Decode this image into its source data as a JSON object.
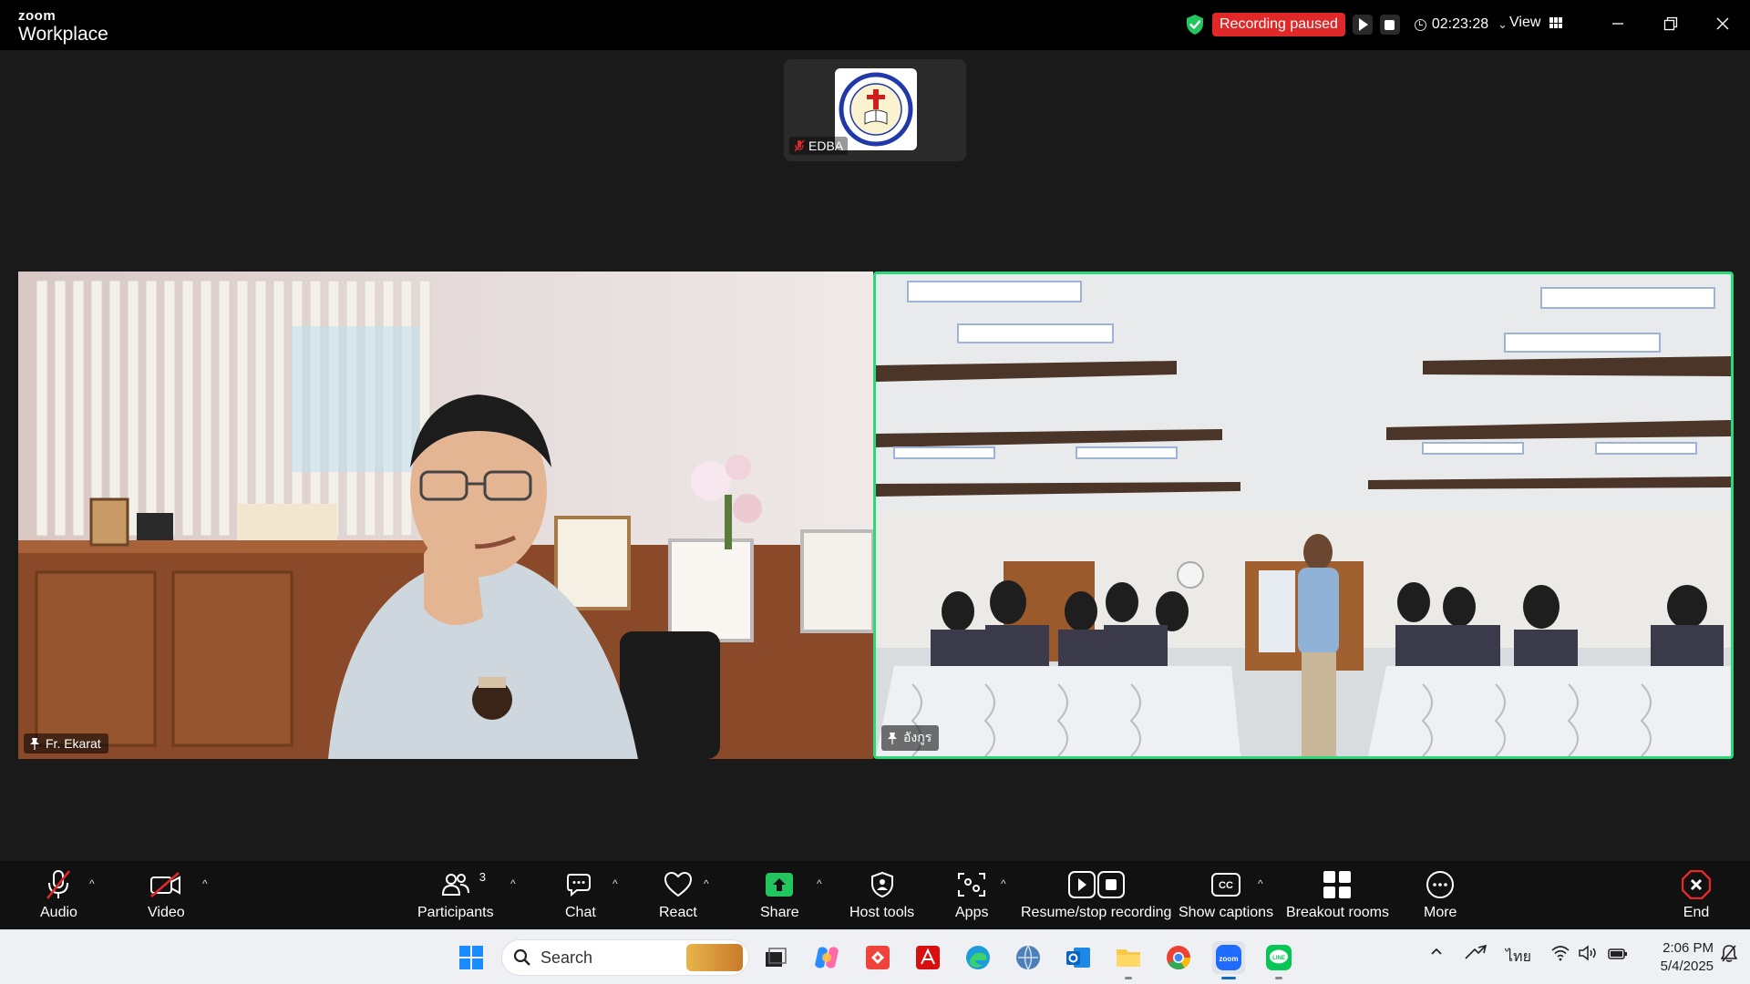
{
  "app": {
    "brand_top": "zoom",
    "brand_bottom": "Workplace"
  },
  "recording": {
    "status": "Recording paused",
    "elapsed": "02:23:28"
  },
  "titlebar": {
    "view_label": "View"
  },
  "participants_tiles": {
    "thumbnail": {
      "name": "EDBA",
      "muted": true
    },
    "left": {
      "name": "Fr. Ekarat",
      "pinned": true
    },
    "right": {
      "name": "อังกูร",
      "pinned": true,
      "active_speaker": true
    }
  },
  "toolbar": {
    "audio": "Audio",
    "video": "Video",
    "participants": "Participants",
    "participants_count": "3",
    "chat": "Chat",
    "react": "React",
    "share": "Share",
    "host_tools": "Host tools",
    "apps": "Apps",
    "recording": "Resume/stop recording",
    "captions": "Show captions",
    "breakout": "Breakout rooms",
    "more": "More",
    "end": "End"
  },
  "colors": {
    "accent_green": "#2bd97b",
    "recording_red": "#e02828",
    "end_red": "#e02828",
    "share_green": "#22c55e"
  },
  "taskbar": {
    "search_placeholder": "Search",
    "language": "ไทย",
    "time": "2:06 PM",
    "date": "5/4/2025",
    "pinned_apps": [
      "start-icon",
      "search-icon",
      "task-view-icon",
      "copilot-icon",
      "anydesk-icon",
      "acrobat-icon",
      "edge-icon",
      "globe-app-icon",
      "outlook-icon",
      "file-explorer-icon",
      "chrome-icon",
      "zoom-icon",
      "line-icon"
    ]
  }
}
